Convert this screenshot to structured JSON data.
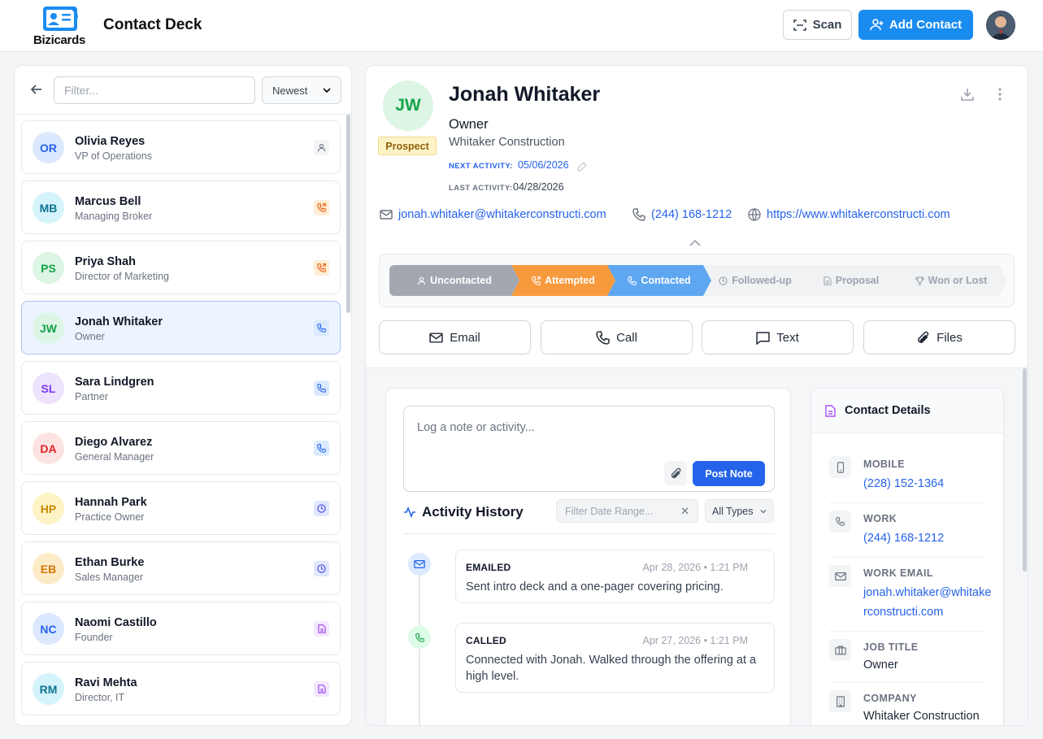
{
  "app": {
    "logo_text": "Bizicards",
    "title": "Contact Deck"
  },
  "header": {
    "scan_label": "Scan",
    "add_contact_label": "Add Contact"
  },
  "list": {
    "filter_placeholder": "Filter...",
    "sort_value": "Newest",
    "contacts": [
      {
        "initials": "OR",
        "name": "Olivia Reyes",
        "role": "VP of Operations",
        "status_icon": "user-icon",
        "avatar_bg": "#dbe8fd",
        "avatar_fg": "#2563eb",
        "status_bg": "#f3f4f6",
        "status_fg": "#6b7280"
      },
      {
        "initials": "MB",
        "name": "Marcus Bell",
        "role": "Managing Broker",
        "status_icon": "phone-outgoing-icon",
        "avatar_bg": "#d5f3fb",
        "avatar_fg": "#0e7490",
        "status_bg": "#ffedd5",
        "status_fg": "#ea580c"
      },
      {
        "initials": "PS",
        "name": "Priya Shah",
        "role": "Director of Marketing",
        "status_icon": "phone-outgoing-icon",
        "avatar_bg": "#dcf5e4",
        "avatar_fg": "#16a34a",
        "status_bg": "#ffedd5",
        "status_fg": "#ea580c"
      },
      {
        "initials": "JW",
        "name": "Jonah Whitaker",
        "role": "Owner",
        "status_icon": "phone-icon",
        "avatar_bg": "#dcf5e4",
        "avatar_fg": "#16a34a",
        "status_bg": "#dbeafe",
        "status_fg": "#2563eb"
      },
      {
        "initials": "SL",
        "name": "Sara Lindgren",
        "role": "Partner",
        "status_icon": "phone-icon",
        "avatar_bg": "#ede3fd",
        "avatar_fg": "#7c3aed",
        "status_bg": "#dbeafe",
        "status_fg": "#2563eb"
      },
      {
        "initials": "DA",
        "name": "Diego Alvarez",
        "role": "General Manager",
        "status_icon": "phone-icon",
        "avatar_bg": "#fde2e2",
        "avatar_fg": "#dc2626",
        "status_bg": "#dbeafe",
        "status_fg": "#2563eb"
      },
      {
        "initials": "HP",
        "name": "Hannah Park",
        "role": "Practice Owner",
        "status_icon": "clock-icon",
        "avatar_bg": "#fdf3c4",
        "avatar_fg": "#ca8a04",
        "status_bg": "#e0e7ff",
        "status_fg": "#4f46e5"
      },
      {
        "initials": "EB",
        "name": "Ethan Burke",
        "role": "Sales Manager",
        "status_icon": "clock-icon",
        "avatar_bg": "#fdebc8",
        "avatar_fg": "#d97706",
        "status_bg": "#e0e7ff",
        "status_fg": "#4f46e5"
      },
      {
        "initials": "NC",
        "name": "Naomi Castillo",
        "role": "Founder",
        "status_icon": "document-icon",
        "avatar_bg": "#dbe8fd",
        "avatar_fg": "#2563eb",
        "status_bg": "#f3e8ff",
        "status_fg": "#9333ea"
      },
      {
        "initials": "RM",
        "name": "Ravi Mehta",
        "role": "Director, IT",
        "status_icon": "document-icon",
        "avatar_bg": "#d5f3fb",
        "avatar_fg": "#0e7490",
        "status_bg": "#f3e8ff",
        "status_fg": "#9333ea"
      }
    ]
  },
  "profile": {
    "initials": "JW",
    "badge": "Prospect",
    "name": "Jonah Whitaker",
    "title": "Owner",
    "company": "Whitaker Construction",
    "next_activity_label": "NEXT ACTIVITY:",
    "next_activity": "05/06/2026",
    "last_activity_label": "LAST ACTIVITY:",
    "last_activity": "04/28/2026",
    "email": "jonah.whitaker@whitakerconstructi.com",
    "phone": "(244) 168-1212",
    "website": "https://www.whitakerconstructi.com"
  },
  "pipeline": [
    {
      "label": "Uncontacted",
      "icon": "user-icon",
      "state": "done"
    },
    {
      "label": "Attempted",
      "icon": "phone-outgoing-icon",
      "state": "done"
    },
    {
      "label": "Contacted",
      "icon": "phone-icon",
      "state": "current"
    },
    {
      "label": "Followed-up",
      "icon": "clock-icon",
      "state": "todo"
    },
    {
      "label": "Proposal",
      "icon": "document-icon",
      "state": "todo"
    },
    {
      "label": "Won or Lost",
      "icon": "trophy-icon",
      "state": "todo"
    }
  ],
  "actions": {
    "email": "Email",
    "call": "Call",
    "text": "Text",
    "files": "Files"
  },
  "note": {
    "placeholder": "Log a note or activity...",
    "post_label": "Post Note"
  },
  "activity": {
    "title": "Activity History",
    "date_filter_placeholder": "Filter Date Range...",
    "type_filter": "All Types",
    "items": [
      {
        "type": "EMAILED",
        "time": "Apr 28, 2026 • 1:21 PM",
        "text": "Sent intro deck and a one-pager covering pricing.",
        "icon": "mail-icon"
      },
      {
        "type": "CALLED",
        "time": "Apr 27, 2026 • 1:21 PM",
        "text": "Connected with Jonah. Walked through the offering at a high level.",
        "icon": "phone-icon"
      }
    ]
  },
  "details": {
    "title": "Contact Details",
    "fields": [
      {
        "label": "MOBILE",
        "value": "(228) 152-1364",
        "link": true,
        "icon": "mobile-icon"
      },
      {
        "label": "WORK",
        "value": "(244) 168-1212",
        "link": true,
        "icon": "phone-icon"
      },
      {
        "label": "WORK EMAIL",
        "value": "jonah.whitaker@whitakerconstructi.com",
        "link": true,
        "icon": "mail-icon"
      },
      {
        "label": "JOB TITLE",
        "value": "Owner",
        "link": false,
        "icon": "briefcase-icon"
      },
      {
        "label": "COMPANY",
        "value": "Whitaker Construction",
        "link": false,
        "icon": "building-icon"
      }
    ]
  },
  "colors": {
    "accent": "#1a8cf0",
    "primary": "#2563eb",
    "attempted": "#f79a3e",
    "contacted": "#5ea7f0",
    "uncontacted": "#a3a8b0"
  }
}
